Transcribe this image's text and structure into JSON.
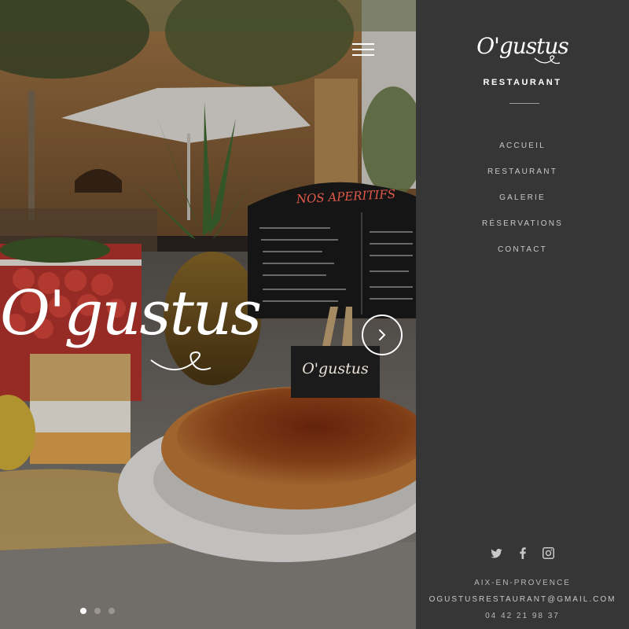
{
  "hero": {
    "logo_text": "O'gustus",
    "board_title": "NOS APERITIFS",
    "placard_text": "O'gustus",
    "slides": [
      {
        "active": true
      },
      {
        "active": false
      },
      {
        "active": false
      }
    ]
  },
  "icons": {
    "menu": "hamburger-icon",
    "next": "chevron-right-icon",
    "twitter": "twitter-icon",
    "facebook": "facebook-icon",
    "instagram": "instagram-icon"
  },
  "sidebar": {
    "brand": "O'gustus",
    "subtitle": "RESTAURANT",
    "nav": [
      {
        "label": "ACCUEIL"
      },
      {
        "label": "RESTAURANT"
      },
      {
        "label": "GALERIE"
      },
      {
        "label": "RÉSERVATIONS"
      },
      {
        "label": "CONTACT"
      }
    ],
    "city": "AIX-EN-PROVENCE",
    "email": "OGUSTUSRESTAURANT@GMAIL.COM",
    "phone": "04 42 21 98 37"
  },
  "colors": {
    "sidebar_bg": "#363636",
    "text_light": "#c8c8c8",
    "accent_red": "#e25a4a"
  }
}
